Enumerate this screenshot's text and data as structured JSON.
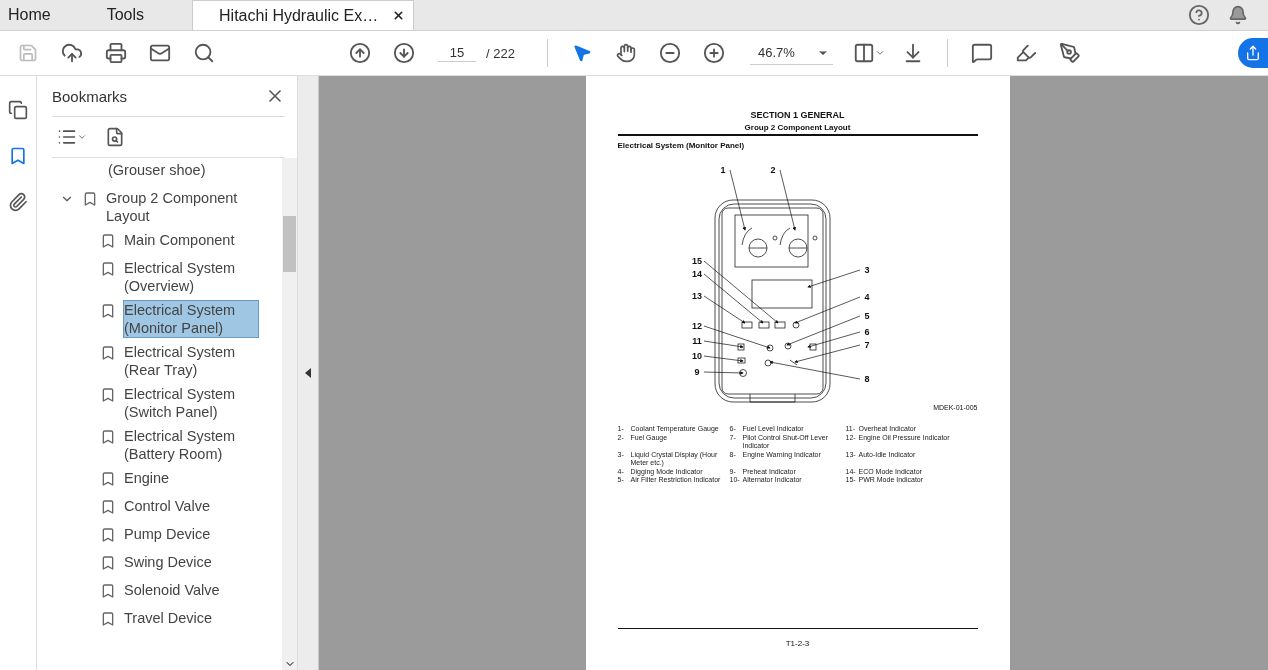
{
  "top_tabs": [
    {
      "label": "Home",
      "selected": false
    },
    {
      "label": "Tools",
      "selected": false
    },
    {
      "label": "Hitachi Hydraulic Ex…",
      "selected": true
    }
  ],
  "toolbar": {
    "page_current": "15",
    "page_total": "/ 222",
    "zoom": "46.7%",
    "tools": [
      {
        "kind": "select",
        "selected": true
      },
      {
        "kind": "hand",
        "selected": false
      }
    ]
  },
  "side_rail": [
    {
      "kind": "pages",
      "selected": false
    },
    {
      "kind": "bookmarks",
      "selected": true
    },
    {
      "kind": "attachments",
      "selected": false
    }
  ],
  "bookmarks": {
    "title": "Bookmarks",
    "items": [
      {
        "label": "(Grouser shoe)",
        "selected": false
      },
      {
        "label": "Group 2 Component Layout",
        "selected": false,
        "expanded": true,
        "children": [
          {
            "label": "Main Component",
            "selected": false
          },
          {
            "label": "Electrical System (Overview)",
            "selected": false
          },
          {
            "label": "Electrical System (Monitor Panel)",
            "selected": true
          },
          {
            "label": "Electrical System (Rear Tray)",
            "selected": false
          },
          {
            "label": "Electrical System (Switch Panel)",
            "selected": false
          },
          {
            "label": "Electrical System (Battery Room)",
            "selected": false
          },
          {
            "label": "Engine",
            "selected": false
          },
          {
            "label": "Control Valve",
            "selected": false
          },
          {
            "label": "Pump Device",
            "selected": false
          },
          {
            "label": "Swing Device",
            "selected": false
          },
          {
            "label": "Solenoid Valve",
            "selected": false
          },
          {
            "label": "Travel Device",
            "selected": false
          }
        ]
      }
    ]
  },
  "document": {
    "section": "SECTION 1 GENERAL",
    "group": "Group 2 Component Layout",
    "heading": "Electrical System (Monitor Panel)",
    "callouts": [
      "1",
      "2",
      "15",
      "3",
      "14",
      "13",
      "4",
      "5",
      "12",
      "6",
      "11",
      "7",
      "10",
      "9",
      "8"
    ],
    "figure_id": "MDEK-01-005",
    "legend": [
      {
        "num": "1-",
        "text": "Coolant Temperature Gauge"
      },
      {
        "num": "2-",
        "text": "Fuel Gauge"
      },
      {
        "num": "3-",
        "text": "Liquid Crystal Display (Hour Meter etc.)"
      },
      {
        "num": "4-",
        "text": "Digging Mode Indicator"
      },
      {
        "num": "5-",
        "text": "Air Filter Restriction Indicator"
      },
      {
        "num": "6-",
        "text": "Fuel Level Indicator"
      },
      {
        "num": "7-",
        "text": "Pilot Control Shut-Off Lever Indicator"
      },
      {
        "num": "8-",
        "text": "Engine Warning Indicator"
      },
      {
        "num": "9-",
        "text": "Preheat Indicator"
      },
      {
        "num": "10-",
        "text": "Alternator Indicator"
      },
      {
        "num": "11-",
        "text": "Overheat Indicator"
      },
      {
        "num": "12-",
        "text": "Engine Oil Pressure Indicator"
      },
      {
        "num": "13-",
        "text": "Auto-Idle Indicator"
      },
      {
        "num": "14-",
        "text": "ECO Mode Indicator"
      },
      {
        "num": "15-",
        "text": "PWR Mode Indicator"
      }
    ],
    "page_number": "T1-2-3"
  }
}
